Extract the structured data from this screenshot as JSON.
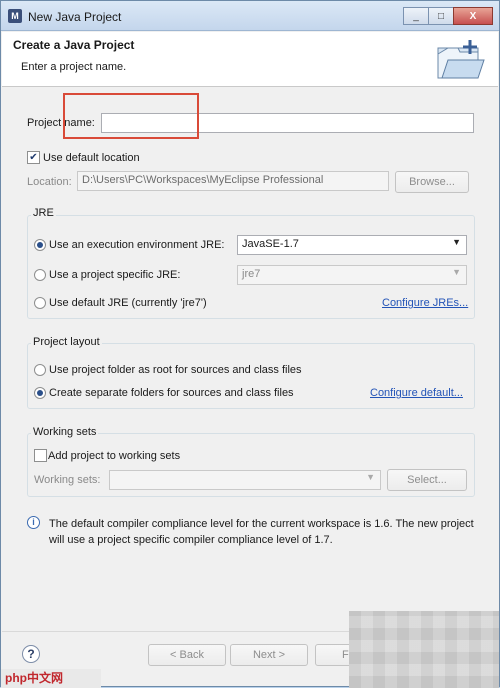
{
  "window": {
    "title": "New Java Project",
    "controls": [
      "_",
      "□",
      "X"
    ]
  },
  "banner": {
    "title": "Create a Java Project",
    "subtitle": "Enter a project name."
  },
  "project": {
    "name_label": "Project name:",
    "name_value": "",
    "use_default_location_label": "Use default location",
    "use_default_location_checked": true,
    "location_label": "Location:",
    "location_value": "D:\\Users\\PC\\Workspaces\\MyEclipse Professional",
    "browse_label": "Browse..."
  },
  "jre": {
    "group_title": "JRE",
    "options": [
      {
        "label": "Use an execution environment JRE:",
        "selected": true,
        "value": "JavaSE-1.7"
      },
      {
        "label": "Use a project specific JRE:",
        "selected": false,
        "value": "jre7"
      },
      {
        "label": "Use default JRE (currently 'jre7')",
        "selected": false
      }
    ],
    "configure_link": "Configure JREs..."
  },
  "layout": {
    "group_title": "Project layout",
    "options": [
      {
        "label": "Use project folder as root for sources and class files",
        "selected": false
      },
      {
        "label": "Create separate folders for sources and class files",
        "selected": true
      }
    ],
    "configure_link": "Configure default..."
  },
  "working_sets": {
    "group_title": "Working sets",
    "add_label": "Add project to working sets",
    "add_checked": false,
    "field_label": "Working sets:",
    "select_label": "Select..."
  },
  "info": {
    "message": "The default compiler compliance level for the current workspace is 1.6. The new project will use a project specific compiler compliance level of 1.7."
  },
  "footer": {
    "help": "?",
    "back_label": "< Back",
    "next_label": "Next >",
    "finish_label": "Fi"
  },
  "watermark": "php中文网",
  "colors": {
    "highlight": "#d94a38",
    "link": "#2354b7"
  }
}
